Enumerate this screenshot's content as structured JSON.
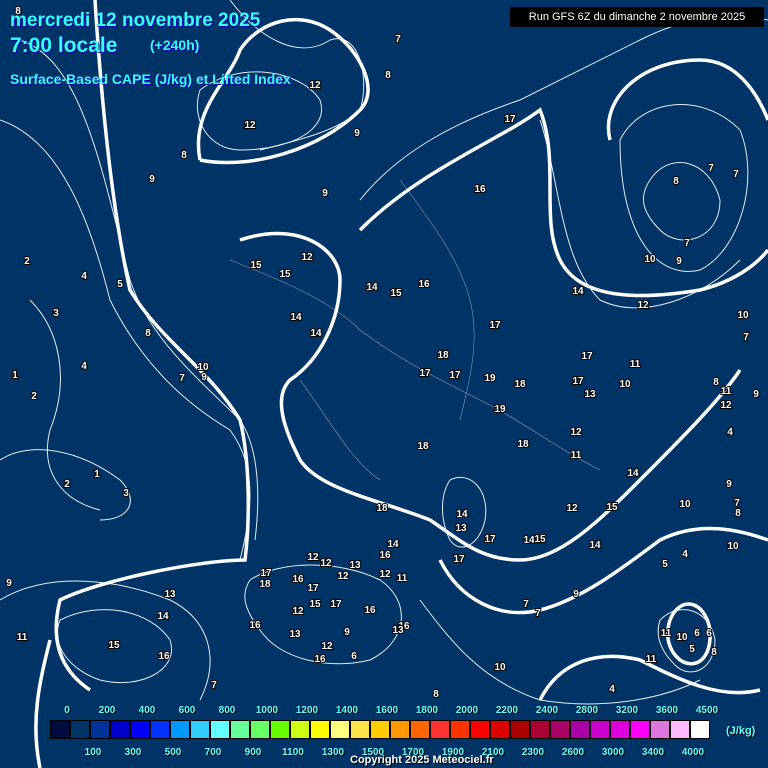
{
  "header": {
    "date": "mercredi 12 novembre 2025",
    "time": "7:00 locale",
    "lead": "(+240h)",
    "product": "Surface-Based CAPE (J/kg) et Lifted Index",
    "run": "Run GFS 6Z du dimanche 2 novembre 2025"
  },
  "legend": {
    "unit": "(J/kg)",
    "top_labels": [
      "0",
      "200",
      "400",
      "600",
      "800",
      "1000",
      "1200",
      "1400",
      "1600",
      "1800",
      "2000",
      "2200",
      "2400",
      "2800",
      "3200",
      "3600",
      "4500"
    ],
    "bottom_labels": [
      "100",
      "300",
      "500",
      "700",
      "900",
      "1100",
      "1300",
      "1500",
      "1700",
      "1900",
      "2100",
      "2300",
      "2600",
      "3000",
      "3400",
      "4000"
    ],
    "colors": [
      "#000b3f",
      "#003366",
      "#003399",
      "#0000cc",
      "#0000ff",
      "#0033ff",
      "#0099ff",
      "#33ccff",
      "#66ffff",
      "#66ff99",
      "#66ff66",
      "#66ff00",
      "#ccff14",
      "#ffff00",
      "#ffff80",
      "#ffe64d",
      "#ffcc00",
      "#ff9900",
      "#ff6600",
      "#ff3333",
      "#ff3300",
      "#ff0000",
      "#dd0000",
      "#aa0000",
      "#aa0033",
      "#aa0066",
      "#aa00aa",
      "#cc00cc",
      "#dd00dd",
      "#ff00ff",
      "#dd77dd",
      "#ffbbff",
      "#ffffff"
    ]
  },
  "contour_labels": [
    "8",
    "7",
    "8",
    "12",
    "12",
    "9",
    "8",
    "9",
    "9",
    "17",
    "16",
    "8",
    "7",
    "7",
    "7",
    "10",
    "9",
    "2",
    "4",
    "5",
    "15",
    "15",
    "12",
    "14",
    "15",
    "16",
    "14",
    "12",
    "10",
    "3",
    "8",
    "14",
    "14",
    "17",
    "7",
    "18",
    "17",
    "11",
    "4",
    "10",
    "7",
    "9",
    "1",
    "17",
    "17",
    "19",
    "18",
    "17",
    "10",
    "8",
    "13",
    "11",
    "9",
    "2",
    "19",
    "12",
    "12",
    "4",
    "18",
    "18",
    "11",
    "1",
    "14",
    "2",
    "9",
    "3",
    "18",
    "14",
    "12",
    "15",
    "10",
    "7",
    "8",
    "13",
    "17",
    "14",
    "15",
    "14",
    "10",
    "14",
    "16",
    "12",
    "12",
    "13",
    "17",
    "4",
    "5",
    "17",
    "18",
    "16",
    "17",
    "12",
    "12",
    "11",
    "9",
    "13",
    "9",
    "15",
    "17",
    "12",
    "16",
    "7",
    "7",
    "14",
    "16",
    "16",
    "13",
    "13",
    "9",
    "11",
    "10",
    "6",
    "6",
    "11",
    "15",
    "12",
    "5",
    "8",
    "16",
    "16",
    "6",
    "11",
    "10",
    "7",
    "8",
    "4"
  ],
  "copyright": "Copyright 2025 Meteociel.fr"
}
